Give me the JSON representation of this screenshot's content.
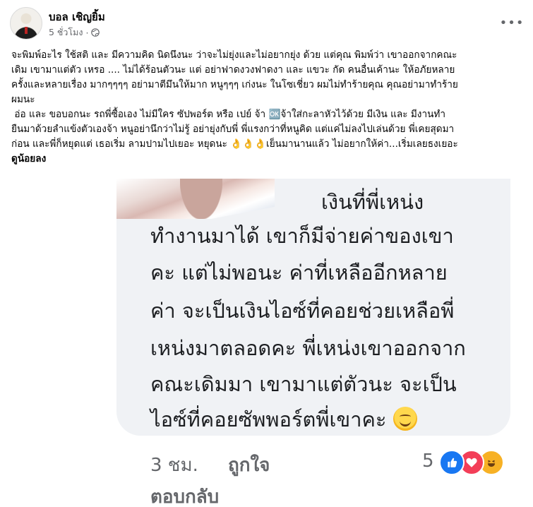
{
  "post": {
    "author": "บอล เชิญยิ้ม",
    "avatar_caption": "",
    "time": "5 ชั่วโมง",
    "separator": "·",
    "privacy_icon": "globe-icon",
    "more_icon": "more-dots-icon",
    "more_label": "•••",
    "text_lines": [
      "จะพิมพ์อะไร ใช้สติ และ มีความคิด นิดนึงนะ ว่าจะไม่ยุ่งและไม่อยากยุ่ง ด้วย แต่คุณ พิมพ์ว่า เขาออกจากคณะ",
      "เดิม เขามาแต่ตัว เหรอ .... ไม่ได้ร้อนตัวนะ แต่ อย่าฟาดงวงฟาดงา และ แขวะ กัด คนอื่นเค้านะ ให้อภัยหลาย",
      "ครั้งและหลายเรื่อง มากๆๆๆๆ อย่ามาตีมึนให้มาก หนูๆๆๆ เก่งนะ ในโซเชี่ยว ผมไม่ทำร้ายคุณ คุณอย่ามาทำร้าย",
      "ผมนะ",
      " อ่อ และ ขอบอกนะ รถพี่ซื้อเอง ไม่มีใคร ซัปพอร์ต หรือ เปย์ จ้า 🆗จ้าใส่กะลาหัวไว้ด้วย มีเงิน และ มีงานทำ",
      "ยืนมาด้วยลำแข้งตัวเองจ้า หนูอย่านึกว่าไม่รู้ อย่ายุ่งกับพี่ พี่แรงกว่าที่หนูคิด แต่แค่ไม่ลงไปเล่นด้วย พี่เคยสุดมา",
      "ก่อน และพี่ก็หยุดแต่ เธอเริ่ม ลามปามไปเยอะ หยุดนะ 👌👌👌เย็นมานานแล้ว ไม่อยากให้ค่า...เริ่มเลยธงเยอะ"
    ],
    "text_end_bold": "ดูน้อยลง"
  },
  "screenshot": {
    "comment_lines": [
      "เงินที่พี่เหน่ง",
      "ทำงานมาได้ เขาก็มีจ่ายค่าของเขา",
      "คะ แต่ไม่พอนะ ค่าที่เหลืออีกหลาย",
      "ค่า จะเป็นเงินไอซ์ที่คอยช่วยเหลือพี่",
      "เหน่งมาตลอดคะ พี่เหน่งเขาออกจาก",
      "คณะเดิมมา เขามาแต่ตัวนะ จะเป็น",
      "ไอซ์ที่คอยซัพพอร์ตพี่เขาคะ"
    ],
    "comment_emoji": "smiling-face-icon",
    "time_ago": "3 ชม.",
    "like_action": "ถูกใจ",
    "reply_action": "ตอบกลับ",
    "reaction_count": "5",
    "reactions": [
      "like-icon",
      "love-icon",
      "haha-icon"
    ]
  },
  "colors": {
    "text": "#050505",
    "muted": "#65676b",
    "bubble": "#f0f2f5",
    "like": "#1877f2",
    "love": "#f33e58",
    "haha": "#f7b125"
  }
}
